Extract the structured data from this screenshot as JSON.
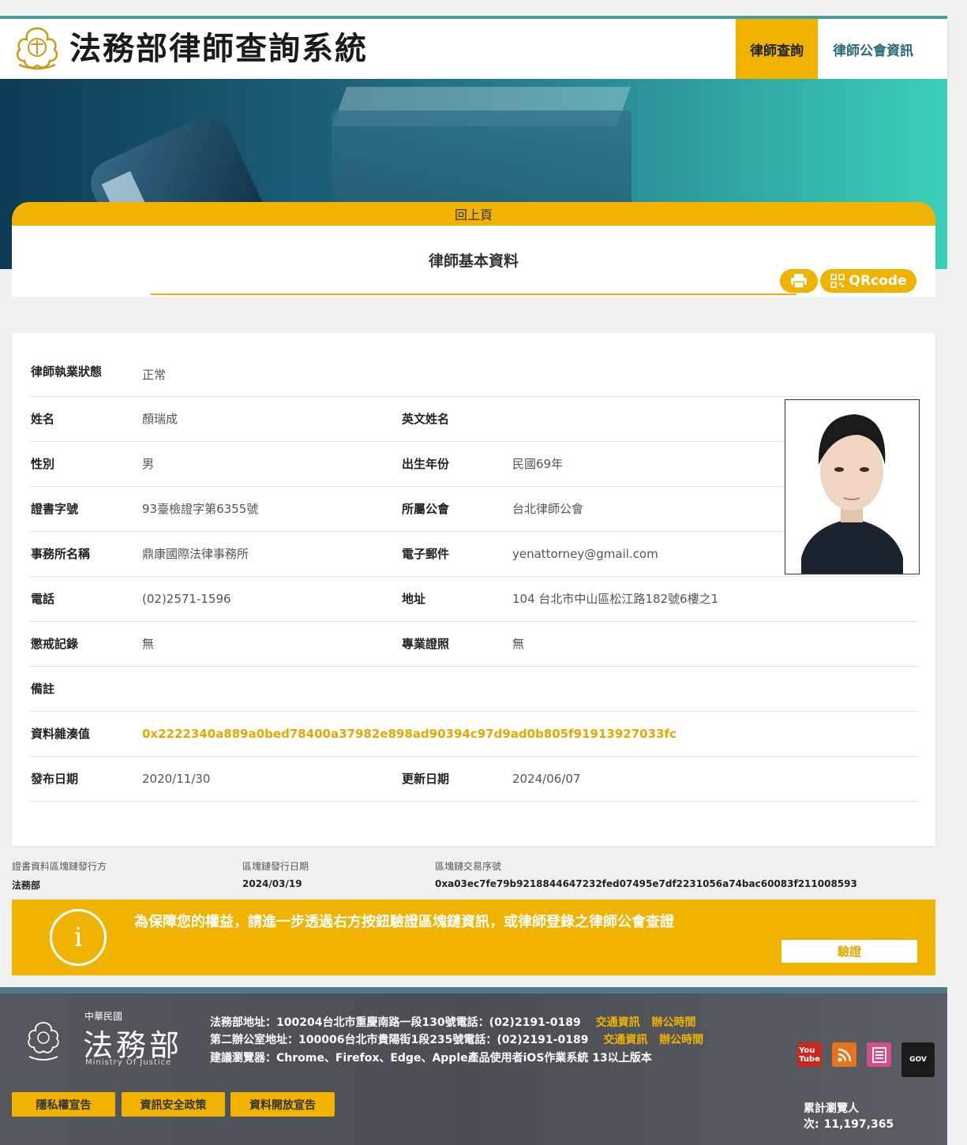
{
  "header": {
    "site_title": "法務部律師查詢系統",
    "nav": [
      "律師查詢",
      "律師公會資訊"
    ]
  },
  "card": {
    "back_label": "回上頁",
    "title": "律師基本資料",
    "qr_label": "QRcode"
  },
  "profile": {
    "status_label": "律師執業狀態",
    "status_value": "正常",
    "name_label": "姓名",
    "name_value": "顏瑞成",
    "en_name_label": "英文姓名",
    "en_name_value": "",
    "gender_label": "性別",
    "gender_value": "男",
    "birth_label": "出生年份",
    "birth_value": "民國69年",
    "cert_label": "證書字號",
    "cert_value": "93臺檢證字第6355號",
    "assoc_label": "所屬公會",
    "assoc_value": "台北律師公會",
    "firm_label": "事務所名稱",
    "firm_value": "鼎康國際法律事務所",
    "email_label": "電子郵件",
    "email_value": "yenattorney@gmail.com",
    "phone_label": "電話",
    "phone_value": "(02)2571-1596",
    "address_label": "地址",
    "address_value": "104 台北市中山區松江路182號6樓之1",
    "discipline_label": "懲戒記錄",
    "discipline_value": "無",
    "specialty_label": "專業證照",
    "specialty_value": "無",
    "note_label": "備註",
    "note_value": "",
    "hash_label": "資料雜湊值",
    "hash_value": "0x2222340a889a0bed78400a37982e898ad90394c97d9ad0b805f91913927033fc",
    "publish_label": "發布日期",
    "publish_value": "2020/11/30",
    "update_label": "更新日期",
    "update_value": "2024/06/07"
  },
  "chain": {
    "issuer_label": "證書資料區塊鏈發行方",
    "issuer_value": "法務部",
    "date_label": "區塊鏈發行日期",
    "date_value": "2024/03/19",
    "tx_label": "區塊鏈交易序號",
    "tx_value": "0xa03ec7fe79b9218844647232fed07495e7df2231056a74bac60083f211008593"
  },
  "notice": {
    "text": "為保障您的權益，請進一步透過右方按鈕驗證區塊鏈資訊，或律師登錄之律師公會查證",
    "verify_label": "驗證"
  },
  "footer": {
    "roc": "中華民國",
    "org_name": "法務部",
    "org_en": "Ministry Of Justice",
    "line1": "法務部地址：100204台北市重慶南路一段130號電話：(02)2191-0189",
    "line2": "第二辦公室地址：100006台北市貴陽街1段235號電話：(02)2191-0189",
    "line3": "建議瀏覽器：Chrome、Firefox、Edge、Apple產品使用者iOS作業系統 13以上版本",
    "traffic": "交通資訊",
    "hours": "辦公時間",
    "buttons": [
      "隱私權宣告",
      "資訊安全政策",
      "資料開放宣告"
    ],
    "visits_label": "累計瀏覽人次:",
    "visits_value": "11,197,365"
  },
  "social_icons": [
    "youtube-icon",
    "rss-icon",
    "document-icon",
    "gov-icon"
  ],
  "colors": {
    "accent": "#f0b400",
    "hash": "#e5a800",
    "teal": "#2a6a78"
  }
}
